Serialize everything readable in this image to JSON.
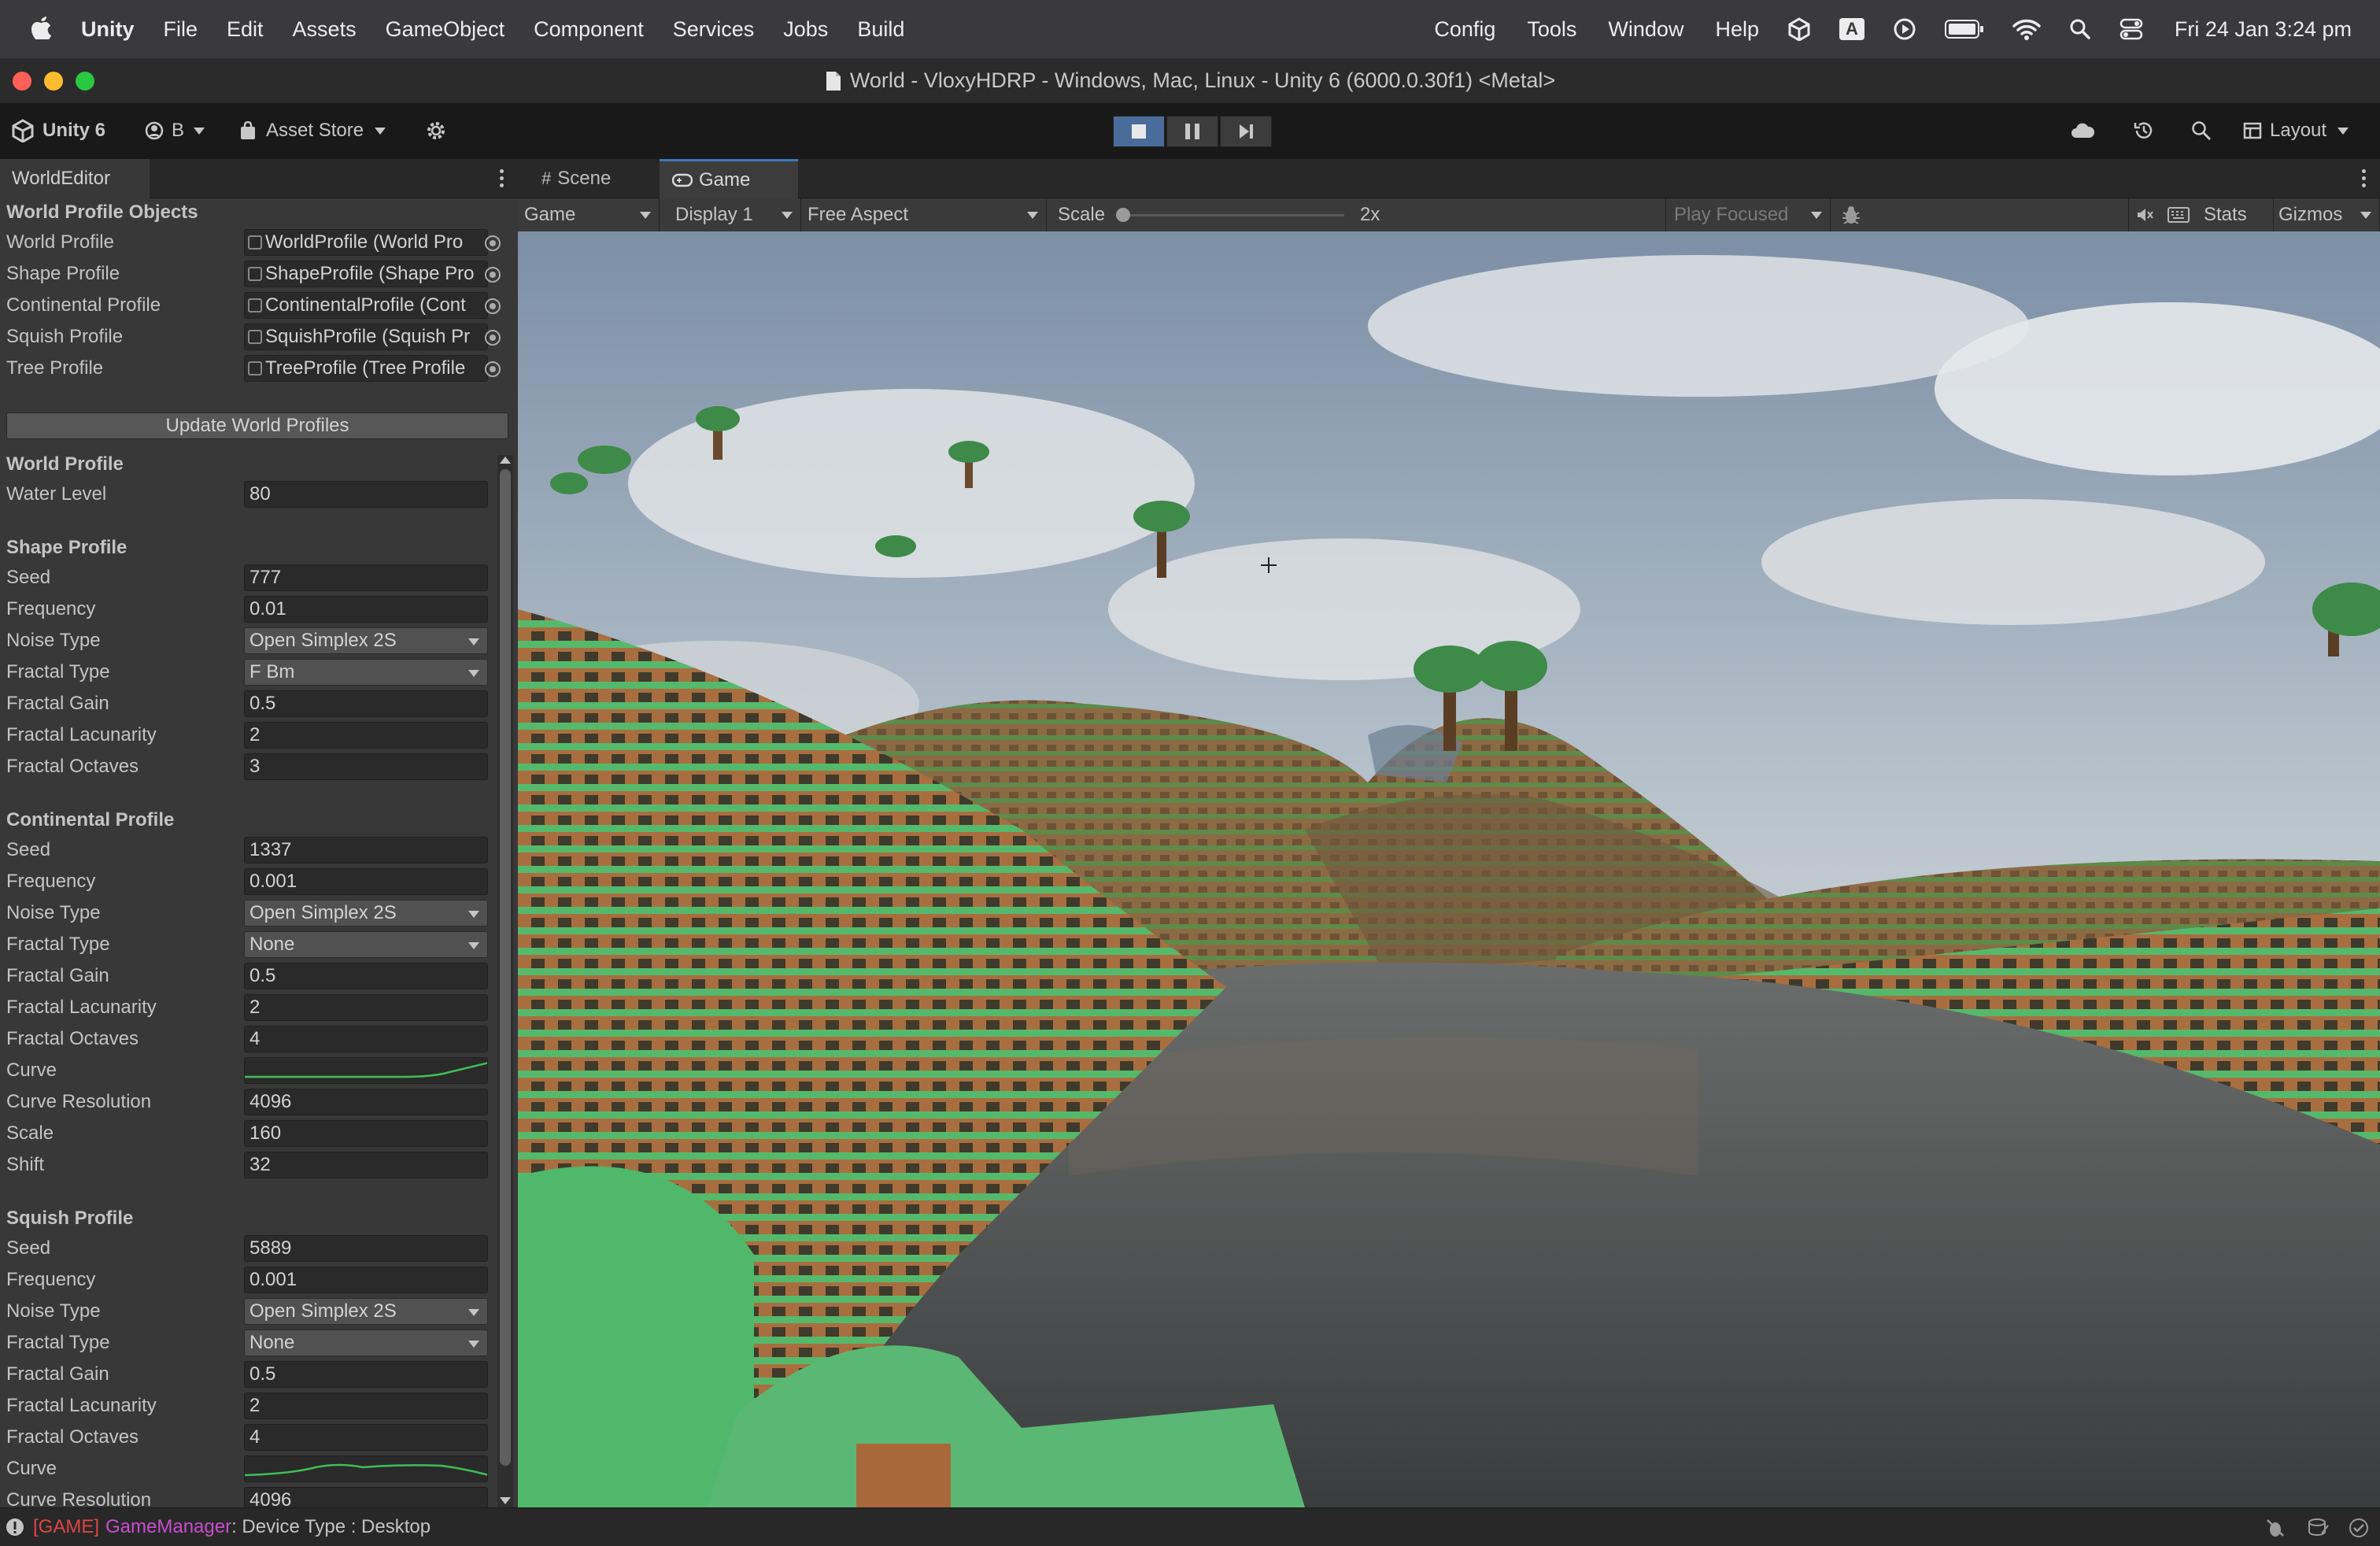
{
  "menubar": {
    "app_name": "Unity",
    "items": [
      "File",
      "Edit",
      "Assets",
      "GameObject",
      "Component",
      "Services",
      "Jobs",
      "Build"
    ],
    "right_items": [
      "Config",
      "Tools",
      "Window",
      "Help"
    ],
    "input_indicator": "A",
    "clock": "Fri 24 Jan  3:24 pm"
  },
  "window": {
    "title": "World - VloxyHDRP - Windows, Mac, Linux - Unity 6 (6000.0.30f1) <Metal>"
  },
  "toolbar": {
    "unity_label": "Unity 6",
    "account_label": "B",
    "asset_store_label": "Asset Store",
    "layout_label": "Layout"
  },
  "left_panel": {
    "tab": "WorldEditor",
    "objects_header": "World Profile Objects",
    "objects": [
      {
        "label": "World Profile",
        "value": "WorldProfile (World Pro"
      },
      {
        "label": "Shape Profile",
        "value": "ShapeProfile (Shape Pro"
      },
      {
        "label": "Continental Profile",
        "value": "ContinentalProfile (Cont"
      },
      {
        "label": "Squish Profile",
        "value": "SquishProfile (Squish Pr"
      },
      {
        "label": "Tree Profile",
        "value": "TreeProfile (Tree Profile"
      }
    ],
    "update_button": "Update World Profiles",
    "world_profile": {
      "header": "World Profile",
      "fields": [
        {
          "label": "Water Level",
          "value": "80"
        }
      ]
    },
    "shape_profile": {
      "header": "Shape Profile",
      "fields": [
        {
          "label": "Seed",
          "value": "777"
        },
        {
          "label": "Frequency",
          "value": "0.01"
        },
        {
          "label": "Noise Type",
          "value": "Open Simplex 2S"
        },
        {
          "label": "Fractal Type",
          "value": "F Bm"
        },
        {
          "label": "Fractal Gain",
          "value": "0.5"
        },
        {
          "label": "Fractal Lacunarity",
          "value": "2"
        },
        {
          "label": "Fractal Octaves",
          "value": "3"
        }
      ]
    },
    "continental_profile": {
      "header": "Continental Profile",
      "fields": [
        {
          "label": "Seed",
          "value": "1337"
        },
        {
          "label": "Frequency",
          "value": "0.001"
        },
        {
          "label": "Noise Type",
          "value": "Open Simplex 2S"
        },
        {
          "label": "Fractal Type",
          "value": "None"
        },
        {
          "label": "Fractal Gain",
          "value": "0.5"
        },
        {
          "label": "Fractal Lacunarity",
          "value": "2"
        },
        {
          "label": "Fractal Octaves",
          "value": "4"
        },
        {
          "label": "Curve",
          "value": ""
        },
        {
          "label": "Curve Resolution",
          "value": "4096"
        },
        {
          "label": "Scale",
          "value": "160"
        },
        {
          "label": "Shift",
          "value": "32"
        }
      ]
    },
    "squish_profile": {
      "header": "Squish Profile",
      "fields": [
        {
          "label": "Seed",
          "value": "5889"
        },
        {
          "label": "Frequency",
          "value": "0.001"
        },
        {
          "label": "Noise Type",
          "value": "Open Simplex 2S"
        },
        {
          "label": "Fractal Type",
          "value": "None"
        },
        {
          "label": "Fractal Gain",
          "value": "0.5"
        },
        {
          "label": "Fractal Lacunarity",
          "value": "2"
        },
        {
          "label": "Fractal Octaves",
          "value": "4"
        },
        {
          "label": "Curve",
          "value": ""
        },
        {
          "label": "Curve Resolution",
          "value": "4096"
        }
      ]
    }
  },
  "game_panel": {
    "tabs": [
      "Scene",
      "Game"
    ],
    "view_dropdown": "Game",
    "display_dropdown": "Display 1",
    "aspect_dropdown": "Free Aspect",
    "scale_label": "Scale",
    "scale_value": "2x",
    "play_mode": "Play Focused",
    "stats_label": "Stats",
    "gizmos_label": "Gizmos"
  },
  "statusbar": {
    "tag": "[GAME]",
    "source": "GameManager",
    "message": ": Device Type : Desktop"
  },
  "colors": {
    "accent": "#3a79bb",
    "status_tag": "#e04545",
    "status_source": "#c84fd0",
    "grass": "#4fb86a",
    "dirt": "#a8683a"
  }
}
